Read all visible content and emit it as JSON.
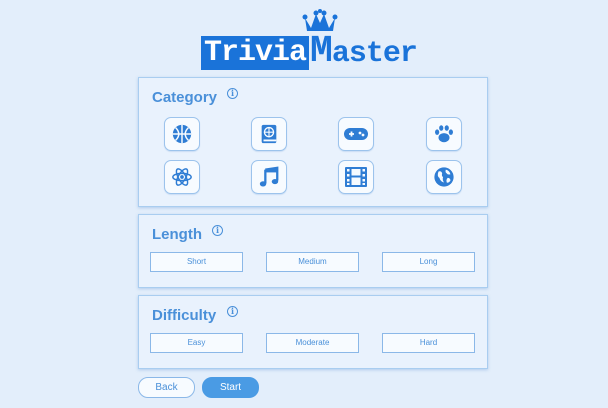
{
  "logo": {
    "part1": "Trivia",
    "part2_initial": "M",
    "part2_rest": "aster"
  },
  "category": {
    "title": "Category",
    "info": "i",
    "items": [
      {
        "icon": "basketball-icon"
      },
      {
        "icon": "book-globe-icon"
      },
      {
        "icon": "gamepad-icon"
      },
      {
        "icon": "paw-icon"
      },
      {
        "icon": "atom-icon"
      },
      {
        "icon": "music-note-icon"
      },
      {
        "icon": "film-icon"
      },
      {
        "icon": "globe-icon"
      }
    ]
  },
  "length": {
    "title": "Length",
    "info": "i",
    "options": [
      "Short",
      "Medium",
      "Long"
    ]
  },
  "difficulty": {
    "title": "Difficulty",
    "info": "i",
    "options": [
      "Easy",
      "Moderate",
      "Hard"
    ]
  },
  "actions": {
    "back": "Back",
    "start": "Start"
  },
  "colors": {
    "accent": "#4a90d9",
    "logo_blue": "#1a73d9",
    "background": "#e3eefb"
  }
}
